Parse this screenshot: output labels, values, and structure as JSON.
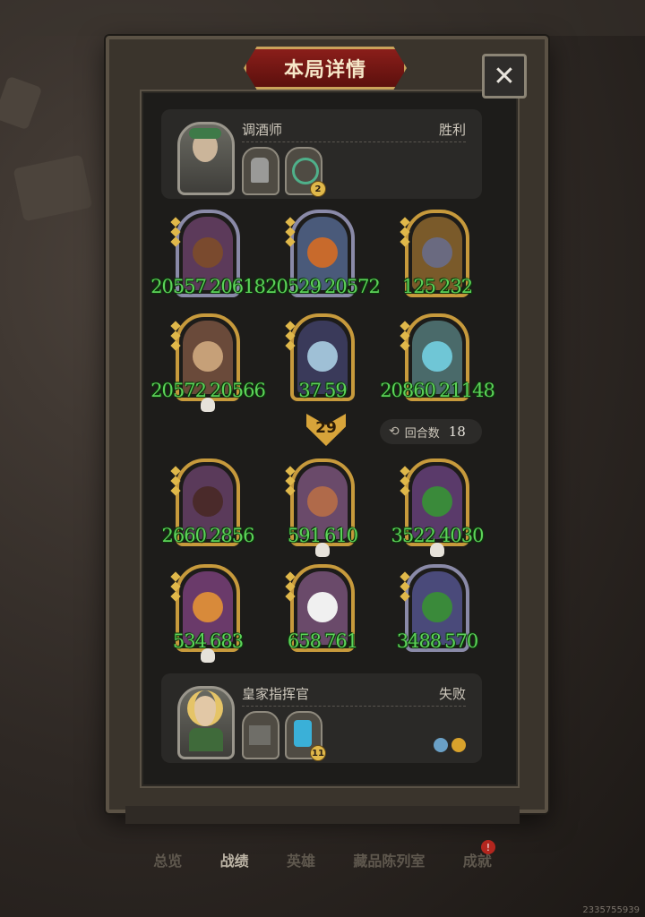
{
  "title": "本局详情",
  "close_label": "✕",
  "top_player": {
    "name": "调酒师",
    "result": "胜利",
    "item2_badge": "2"
  },
  "bottom_player": {
    "name": "皇家指挥官",
    "result": "失败",
    "item2_badge": "11"
  },
  "top_board": [
    {
      "atk": "20557",
      "hp": "20618",
      "frame": "silver"
    },
    {
      "atk": "20529",
      "hp": "20572",
      "frame": "silver"
    },
    {
      "atk": "125",
      "hp": "232",
      "frame": "gold"
    },
    {
      "atk": "20572",
      "hp": "20566",
      "frame": "gold"
    },
    {
      "atk": "37",
      "hp": "59",
      "frame": "gold"
    },
    {
      "atk": "20860",
      "hp": "21148",
      "frame": "gold"
    }
  ],
  "bottom_board": [
    {
      "atk": "2660",
      "hp": "2856",
      "frame": "gold"
    },
    {
      "atk": "591",
      "hp": "610",
      "frame": "gold"
    },
    {
      "atk": "3522",
      "hp": "4030",
      "frame": "gold"
    },
    {
      "atk": "534",
      "hp": "683",
      "frame": "gold"
    },
    {
      "atk": "658",
      "hp": "761",
      "frame": "gold"
    },
    {
      "atk": "3488",
      "hp": "570",
      "frame": "silver"
    }
  ],
  "damage": "29",
  "turns_label": "回合数",
  "turns_value": "18",
  "tabs": [
    "总览",
    "战绩",
    "英雄",
    "藏品陈列室",
    "成就"
  ],
  "active_tab": "战绩",
  "badge": "!",
  "id_text": "2335755939",
  "colors": {
    "stat_green": "#5dd35a",
    "gold_frame": "#c79a3c",
    "title_red": "#8a1e1a"
  }
}
